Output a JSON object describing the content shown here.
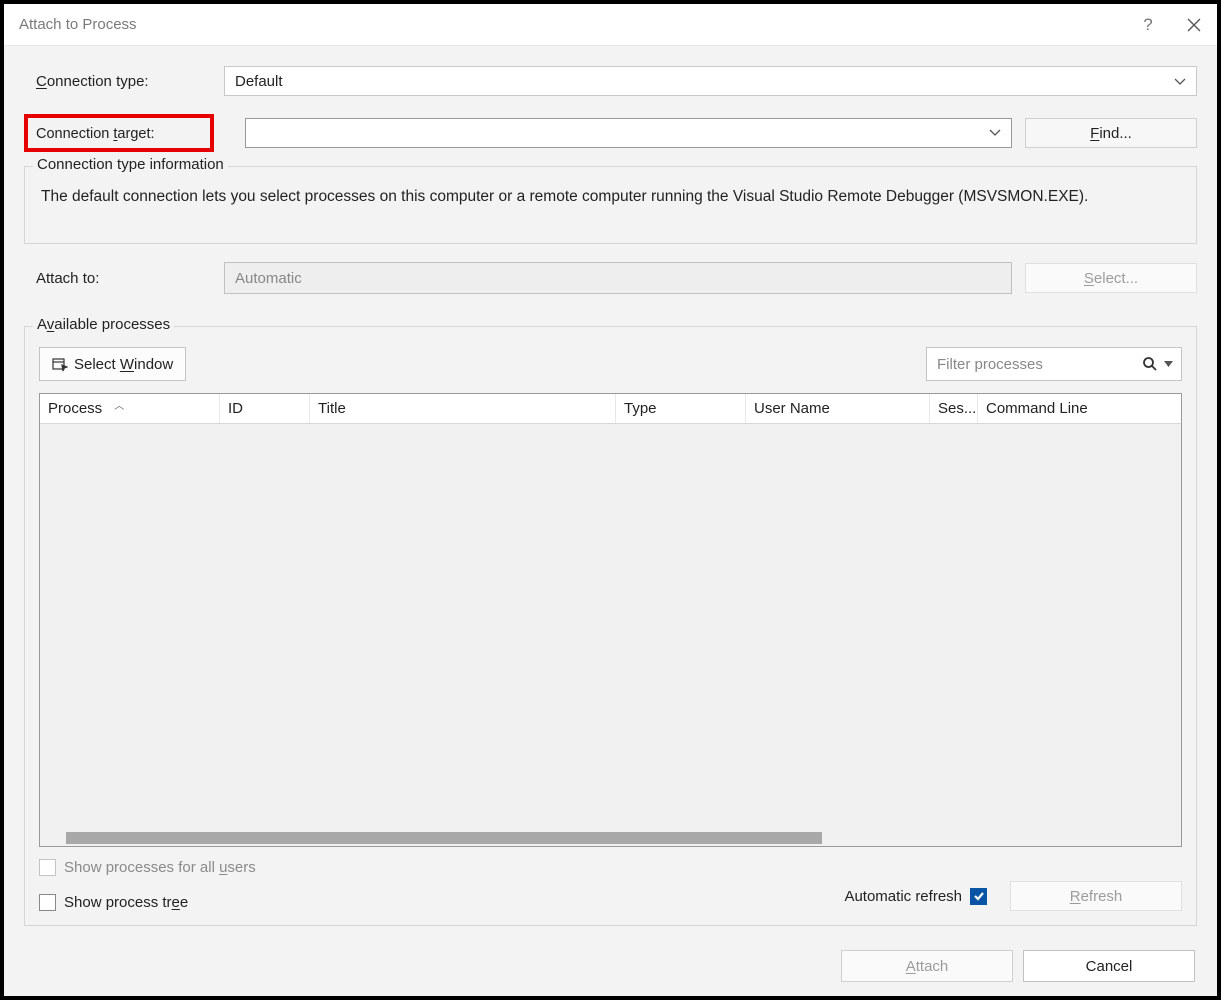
{
  "window": {
    "title": "Attach to Process"
  },
  "labels": {
    "connection_type": "Connection type:",
    "connection_type_hotkey": "C",
    "connection_target": "Connection target:",
    "connection_target_hotkey": "t",
    "attach_to": "Attach to:",
    "available_processes": "Available processes",
    "available_hotkey": "v",
    "conn_type_info_legend": "Connection type information"
  },
  "values": {
    "connection_type_selected": "Default",
    "connection_target_value": "",
    "attach_to_value": "Automatic"
  },
  "buttons": {
    "find": "Find...",
    "find_hotkey": "F",
    "select": "Select...",
    "select_hotkey": "S",
    "select_window": "Select Window",
    "select_window_hotkey": "W",
    "refresh": "Refresh",
    "refresh_hotkey": "R",
    "attach": "Attach",
    "attach_hotkey": "A",
    "cancel": "Cancel"
  },
  "info_text": "The default connection lets you select processes on this computer or a remote computer running the Visual Studio Remote Debugger (MSVSMON.EXE).",
  "filter": {
    "placeholder": "Filter processes"
  },
  "columns": {
    "process": "Process",
    "id": "ID",
    "title": "Title",
    "type": "Type",
    "username": "User Name",
    "session": "Ses...",
    "cmdline": "Command Line"
  },
  "checks": {
    "show_all_users": "Show processes for all users",
    "show_all_users_hotkey": "u",
    "show_tree": "Show process tree",
    "show_tree_hotkey": "e",
    "auto_refresh": "Automatic refresh",
    "auto_refresh_checked": true
  }
}
